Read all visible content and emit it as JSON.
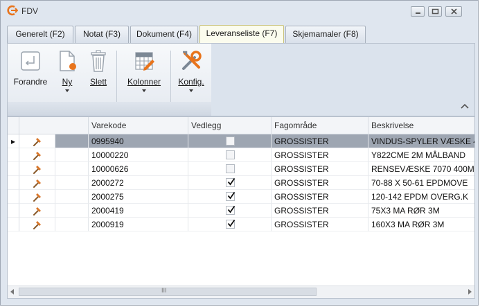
{
  "window": {
    "title": "FDV"
  },
  "tabs": [
    {
      "label": "Generelt (F2)",
      "active": false
    },
    {
      "label": "Notat (F3)",
      "active": false
    },
    {
      "label": "Dokument (F4)",
      "active": false
    },
    {
      "label": "Leveranseliste (F7)",
      "active": true
    },
    {
      "label": "Skjemamaler (F8)",
      "active": false
    }
  ],
  "ribbon": {
    "buttons": [
      {
        "label": "Forandre",
        "icon": "edit-icon",
        "dropdown": false
      },
      {
        "label": "Ny",
        "icon": "new-document-icon",
        "dropdown": true
      },
      {
        "label": "Slett",
        "icon": "trash-icon",
        "dropdown": false
      },
      {
        "label": "Kolonner",
        "icon": "columns-grid-icon",
        "dropdown": true
      },
      {
        "label": "Konfig.",
        "icon": "tools-icon",
        "dropdown": true
      }
    ]
  },
  "table": {
    "columns": [
      "",
      "",
      "Varekode",
      "Vedlegg",
      "Fagområde",
      "Beskrivelse"
    ],
    "rows": [
      {
        "varekode": "0995940",
        "vedlegg": false,
        "fagomrade": "GROSSISTER",
        "beskrivelse": "VINDUS-SPYLER VÆSKE 4",
        "selected": true,
        "indicator": "▸"
      },
      {
        "varekode": "10000220",
        "vedlegg": false,
        "fagomrade": "GROSSISTER",
        "beskrivelse": "Y822CME 2M MÅLBAND",
        "selected": false,
        "indicator": ""
      },
      {
        "varekode": "10000626",
        "vedlegg": false,
        "fagomrade": "GROSSISTER",
        "beskrivelse": "RENSEVÆSKE 7070 400M",
        "selected": false,
        "indicator": ""
      },
      {
        "varekode": "2000272",
        "vedlegg": true,
        "fagomrade": "GROSSISTER",
        "beskrivelse": "70-88 X 50-61 EPDMOVE",
        "selected": false,
        "indicator": ""
      },
      {
        "varekode": "2000275",
        "vedlegg": true,
        "fagomrade": "GROSSISTER",
        "beskrivelse": "120-142 EPDM OVERG.K",
        "selected": false,
        "indicator": ""
      },
      {
        "varekode": "2000419",
        "vedlegg": true,
        "fagomrade": "GROSSISTER",
        "beskrivelse": "75X3 MA RØR 3M",
        "selected": false,
        "indicator": ""
      },
      {
        "varekode": "2000919",
        "vedlegg": true,
        "fagomrade": "GROSSISTER",
        "beskrivelse": "160X3 MA RØR 3M",
        "selected": false,
        "indicator": ""
      }
    ]
  },
  "scrollbar": {
    "thumb_grip": "III"
  },
  "colors": {
    "accent": "#e8741c",
    "selected_row": "#9ea6b2",
    "active_tab": "#fbfcee"
  }
}
